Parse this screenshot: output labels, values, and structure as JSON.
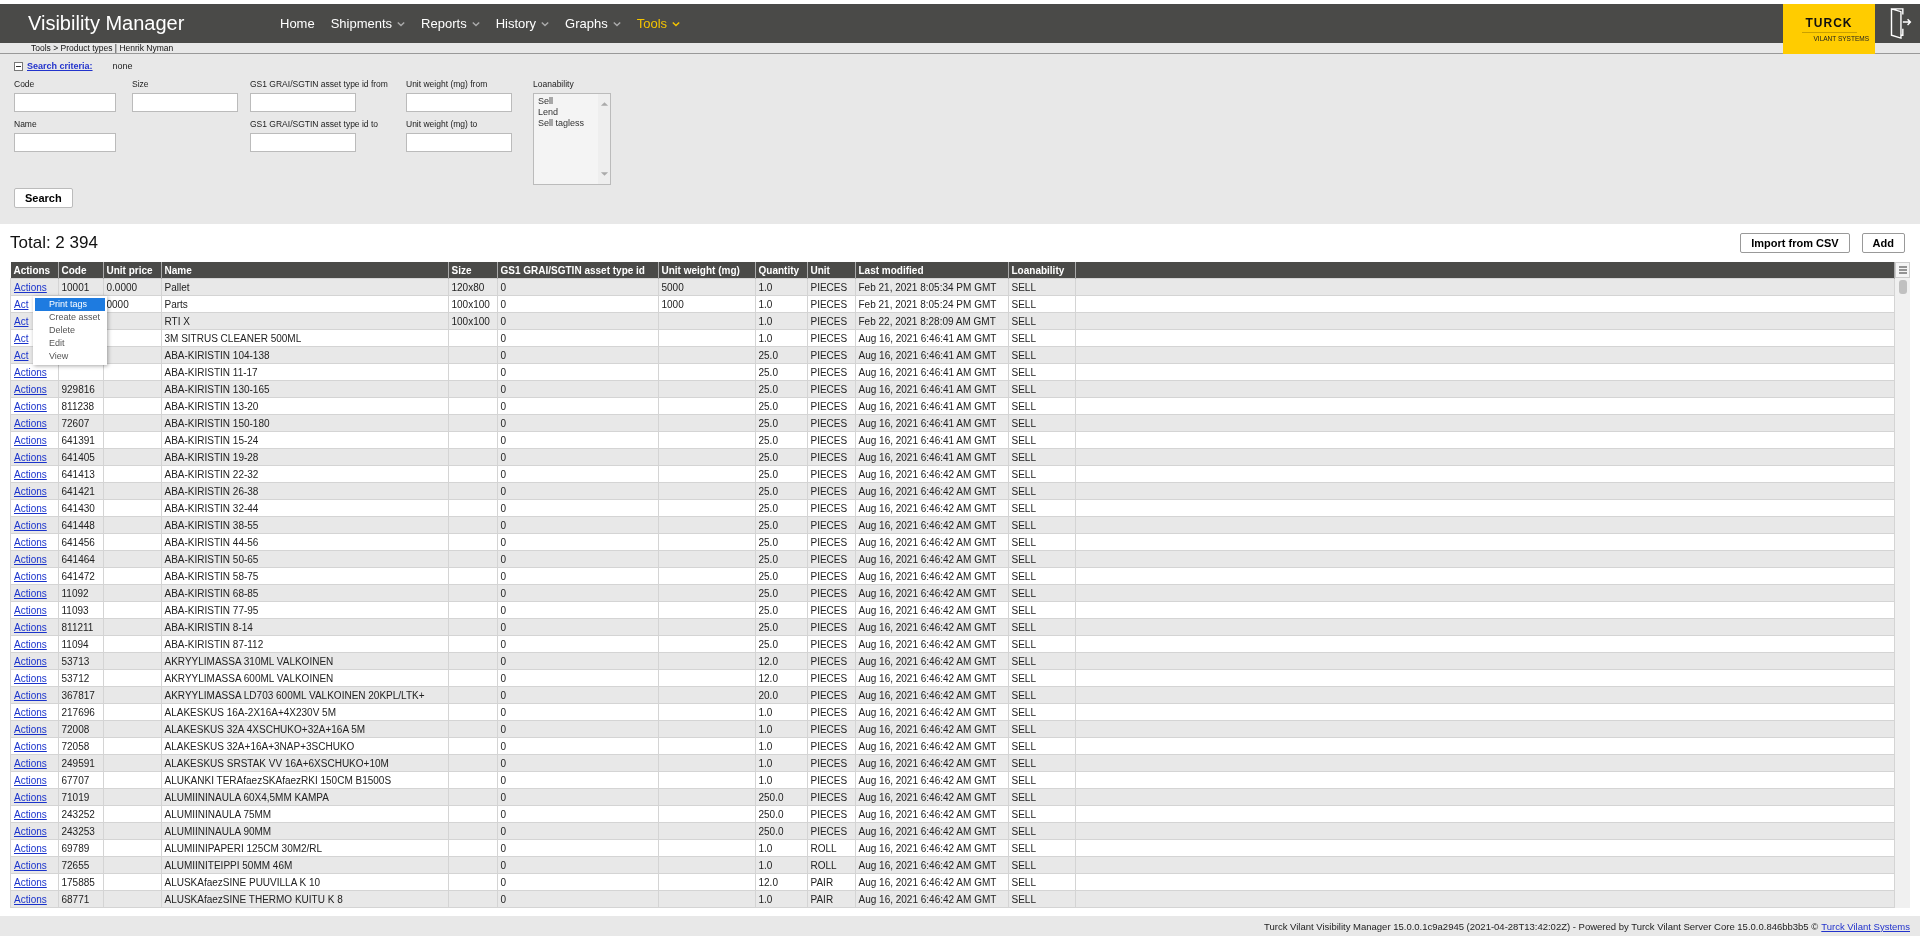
{
  "header": {
    "title": "Visibility Manager",
    "nav": [
      {
        "label": "Home",
        "dropdown": false,
        "selected": false
      },
      {
        "label": "Shipments",
        "dropdown": true,
        "selected": false
      },
      {
        "label": "Reports",
        "dropdown": true,
        "selected": false
      },
      {
        "label": "History",
        "dropdown": true,
        "selected": false
      },
      {
        "label": "Graphs",
        "dropdown": true,
        "selected": false
      },
      {
        "label": "Tools",
        "dropdown": true,
        "selected": true
      }
    ],
    "logo": {
      "brand": "TURCK",
      "subtitle": "VILANT SYSTEMS"
    }
  },
  "breadcrumb": "Tools > Product types | Henrik Nyman",
  "search": {
    "expanded": true,
    "link": "Search criteria:",
    "summary": "none",
    "columns": [
      [
        {
          "label": "Code"
        },
        {
          "label": "Name"
        }
      ],
      [
        {
          "label": "Size"
        }
      ],
      [
        {
          "label": "GS1 GRAI/SGTIN asset type id from"
        },
        {
          "label": "GS1 GRAI/SGTIN asset type id to"
        }
      ],
      [
        {
          "label": "Unit weight (mg) from"
        },
        {
          "label": "Unit weight (mg) to"
        }
      ]
    ],
    "loanability": {
      "label": "Loanability",
      "options": [
        "Sell",
        "Lend",
        "Sell tagless"
      ]
    },
    "button": "Search"
  },
  "total": "Total: 2 394",
  "buttons": [
    "Import from CSV",
    "Add"
  ],
  "table": {
    "columns": [
      "Actions",
      "Code",
      "Unit price",
      "Name",
      "Size",
      "GS1 GRAI/SGTIN asset type id",
      "Unit weight (mg)",
      "Quantity",
      "Unit",
      "Last modified",
      "Loanability"
    ],
    "rows": [
      [
        "Actions",
        "10001",
        "0.0000",
        "Pallet",
        "120x80",
        "0",
        "5000",
        "1.0",
        "PIECES",
        "Feb 21, 2021 8:05:34 PM GMT",
        "SELL"
      ],
      [
        "Act",
        null,
        "0000",
        "Parts",
        "100x100",
        "0",
        "1000",
        "1.0",
        "PIECES",
        "Feb 21, 2021 8:05:24 PM GMT",
        "SELL"
      ],
      [
        "Act",
        null,
        null,
        "RTI X",
        "100x100",
        "0",
        null,
        "1.0",
        "PIECES",
        "Feb 22, 2021 8:28:09 AM GMT",
        "SELL"
      ],
      [
        "Act",
        null,
        null,
        "3M SITRUS CLEANER 500ML",
        null,
        "0",
        null,
        "1.0",
        "PIECES",
        "Aug 16, 2021 6:46:41 AM GMT",
        "SELL"
      ],
      [
        "Act",
        null,
        null,
        "ABA-KIRISTIN 104-138",
        null,
        "0",
        null,
        "25.0",
        "PIECES",
        "Aug 16, 2021 6:46:41 AM GMT",
        "SELL"
      ],
      [
        "Actions",
        null,
        null,
        "ABA-KIRISTIN 11-17",
        null,
        "0",
        null,
        "25.0",
        "PIECES",
        "Aug 16, 2021 6:46:41 AM GMT",
        "SELL"
      ],
      [
        "Actions",
        "929816",
        null,
        "ABA-KIRISTIN 130-165",
        null,
        "0",
        null,
        "25.0",
        "PIECES",
        "Aug 16, 2021 6:46:41 AM GMT",
        "SELL"
      ],
      [
        "Actions",
        "811238",
        null,
        "ABA-KIRISTIN 13-20",
        null,
        "0",
        null,
        "25.0",
        "PIECES",
        "Aug 16, 2021 6:46:41 AM GMT",
        "SELL"
      ],
      [
        "Actions",
        "72607",
        null,
        "ABA-KIRISTIN 150-180",
        null,
        "0",
        null,
        "25.0",
        "PIECES",
        "Aug 16, 2021 6:46:41 AM GMT",
        "SELL"
      ],
      [
        "Actions",
        "641391",
        null,
        "ABA-KIRISTIN 15-24",
        null,
        "0",
        null,
        "25.0",
        "PIECES",
        "Aug 16, 2021 6:46:41 AM GMT",
        "SELL"
      ],
      [
        "Actions",
        "641405",
        null,
        "ABA-KIRISTIN 19-28",
        null,
        "0",
        null,
        "25.0",
        "PIECES",
        "Aug 16, 2021 6:46:41 AM GMT",
        "SELL"
      ],
      [
        "Actions",
        "641413",
        null,
        "ABA-KIRISTIN 22-32",
        null,
        "0",
        null,
        "25.0",
        "PIECES",
        "Aug 16, 2021 6:46:42 AM GMT",
        "SELL"
      ],
      [
        "Actions",
        "641421",
        null,
        "ABA-KIRISTIN 26-38",
        null,
        "0",
        null,
        "25.0",
        "PIECES",
        "Aug 16, 2021 6:46:42 AM GMT",
        "SELL"
      ],
      [
        "Actions",
        "641430",
        null,
        "ABA-KIRISTIN 32-44",
        null,
        "0",
        null,
        "25.0",
        "PIECES",
        "Aug 16, 2021 6:46:42 AM GMT",
        "SELL"
      ],
      [
        "Actions",
        "641448",
        null,
        "ABA-KIRISTIN 38-55",
        null,
        "0",
        null,
        "25.0",
        "PIECES",
        "Aug 16, 2021 6:46:42 AM GMT",
        "SELL"
      ],
      [
        "Actions",
        "641456",
        null,
        "ABA-KIRISTIN 44-56",
        null,
        "0",
        null,
        "25.0",
        "PIECES",
        "Aug 16, 2021 6:46:42 AM GMT",
        "SELL"
      ],
      [
        "Actions",
        "641464",
        null,
        "ABA-KIRISTIN 50-65",
        null,
        "0",
        null,
        "25.0",
        "PIECES",
        "Aug 16, 2021 6:46:42 AM GMT",
        "SELL"
      ],
      [
        "Actions",
        "641472",
        null,
        "ABA-KIRISTIN 58-75",
        null,
        "0",
        null,
        "25.0",
        "PIECES",
        "Aug 16, 2021 6:46:42 AM GMT",
        "SELL"
      ],
      [
        "Actions",
        "11092",
        null,
        "ABA-KIRISTIN 68-85",
        null,
        "0",
        null,
        "25.0",
        "PIECES",
        "Aug 16, 2021 6:46:42 AM GMT",
        "SELL"
      ],
      [
        "Actions",
        "11093",
        null,
        "ABA-KIRISTIN 77-95",
        null,
        "0",
        null,
        "25.0",
        "PIECES",
        "Aug 16, 2021 6:46:42 AM GMT",
        "SELL"
      ],
      [
        "Actions",
        "811211",
        null,
        "ABA-KIRISTIN 8-14",
        null,
        "0",
        null,
        "25.0",
        "PIECES",
        "Aug 16, 2021 6:46:42 AM GMT",
        "SELL"
      ],
      [
        "Actions",
        "11094",
        null,
        "ABA-KIRISTIN 87-112",
        null,
        "0",
        null,
        "25.0",
        "PIECES",
        "Aug 16, 2021 6:46:42 AM GMT",
        "SELL"
      ],
      [
        "Actions",
        "53713",
        null,
        "AKRYYLIMASSA 310ML VALKOINEN",
        null,
        "0",
        null,
        "12.0",
        "PIECES",
        "Aug 16, 2021 6:46:42 AM GMT",
        "SELL"
      ],
      [
        "Actions",
        "53712",
        null,
        "AKRYYLIMASSA 600ML VALKOINEN",
        null,
        "0",
        null,
        "12.0",
        "PIECES",
        "Aug 16, 2021 6:46:42 AM GMT",
        "SELL"
      ],
      [
        "Actions",
        "367817",
        null,
        "AKRYYLIMASSA LD703 600ML VALKOINEN 20KPL/LTK+",
        null,
        "0",
        null,
        "20.0",
        "PIECES",
        "Aug 16, 2021 6:46:42 AM GMT",
        "SELL"
      ],
      [
        "Actions",
        "217696",
        null,
        "ALAKESKUS 16A-2X16A+4X230V 5M",
        null,
        "0",
        null,
        "1.0",
        "PIECES",
        "Aug 16, 2021 6:46:42 AM GMT",
        "SELL"
      ],
      [
        "Actions",
        "72008",
        null,
        "ALAKESKUS 32A 4XSCHUKO+32A+16A 5M",
        null,
        "0",
        null,
        "1.0",
        "PIECES",
        "Aug 16, 2021 6:46:42 AM GMT",
        "SELL"
      ],
      [
        "Actions",
        "72058",
        null,
        "ALAKESKUS 32A+16A+3NAP+3SCHUKO",
        null,
        "0",
        null,
        "1.0",
        "PIECES",
        "Aug 16, 2021 6:46:42 AM GMT",
        "SELL"
      ],
      [
        "Actions",
        "249591",
        null,
        "ALAKESKUS SRSTAK VV 16A+6XSCHUKO+10M",
        null,
        "0",
        null,
        "1.0",
        "PIECES",
        "Aug 16, 2021 6:46:42 AM GMT",
        "SELL"
      ],
      [
        "Actions",
        "67707",
        null,
        "ALUKANKI TERAfaezSKAfaezRKI 150CM B1500S",
        null,
        "0",
        null,
        "1.0",
        "PIECES",
        "Aug 16, 2021 6:46:42 AM GMT",
        "SELL"
      ],
      [
        "Actions",
        "71019",
        null,
        "ALUMIININAULA 60X4,5MM KAMPA",
        null,
        "0",
        null,
        "250.0",
        "PIECES",
        "Aug 16, 2021 6:46:42 AM GMT",
        "SELL"
      ],
      [
        "Actions",
        "243252",
        null,
        "ALUMIININAULA 75MM",
        null,
        "0",
        null,
        "250.0",
        "PIECES",
        "Aug 16, 2021 6:46:42 AM GMT",
        "SELL"
      ],
      [
        "Actions",
        "243253",
        null,
        "ALUMIININAULA 90MM",
        null,
        "0",
        null,
        "250.0",
        "PIECES",
        "Aug 16, 2021 6:46:42 AM GMT",
        "SELL"
      ],
      [
        "Actions",
        "69789",
        null,
        "ALUMIINIPAPERI 125CM 30M2/RL",
        null,
        "0",
        null,
        "1.0",
        "ROLL",
        "Aug 16, 2021 6:46:42 AM GMT",
        "SELL"
      ],
      [
        "Actions",
        "72655",
        null,
        "ALUMIINITEIPPI 50MM 46M",
        null,
        "0",
        null,
        "1.0",
        "ROLL",
        "Aug 16, 2021 6:46:42 AM GMT",
        "SELL"
      ],
      [
        "Actions",
        "175885",
        null,
        "ALUSKAfaezSINE PUUVILLA K 10",
        null,
        "0",
        null,
        "12.0",
        "PAIR",
        "Aug 16, 2021 6:46:42 AM GMT",
        "SELL"
      ],
      [
        "Actions",
        "68771",
        null,
        "ALUSKAfaezSINE THERMO KUITU K 8",
        null,
        "0",
        null,
        "1.0",
        "PAIR",
        "Aug 16, 2021 6:46:42 AM GMT",
        "SELL"
      ]
    ]
  },
  "menu": {
    "items": [
      {
        "label": "Print tags",
        "selected": true
      },
      {
        "label": "Create asset",
        "selected": false
      },
      {
        "label": "Delete",
        "selected": false
      },
      {
        "label": "Edit",
        "selected": false
      },
      {
        "label": "View",
        "selected": false
      }
    ]
  },
  "footer": {
    "text": "Turck Vilant Visibility Manager 15.0.0.1c9a2945 (2021-04-28T13:42:02Z) - Powered by Turck Vilant Server Core 15.0.0.846bb3b5 ©",
    "link": "Turck Vilant Systems"
  }
}
